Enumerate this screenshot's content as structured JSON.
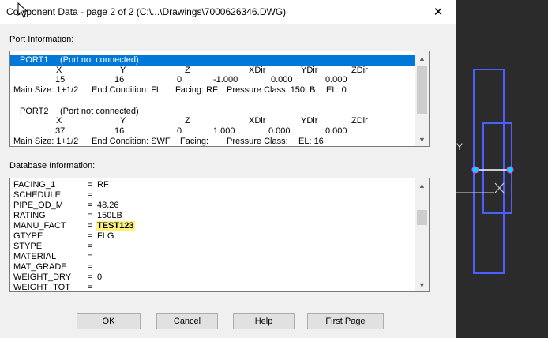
{
  "titlebar": {
    "title": "Component Data - page 2 of 2 (C:\\...\\Drawings\\7000626346.DWG)",
    "close_label": "✕"
  },
  "port_info": {
    "label": "Port Information:",
    "ports": [
      {
        "header": "PORT1",
        "status": "(Port not connected)",
        "col_headers": [
          "X",
          "Y",
          "Z",
          "XDir",
          "YDir",
          "ZDir"
        ],
        "values": [
          "15",
          "16",
          "0",
          "-1.000",
          "0.000",
          "0.000"
        ],
        "main_size": "Main Size: 1+1/2",
        "end_condition": "End Condition: FL",
        "facing": "Facing: RF",
        "pressure_class": "Pressure Class: 150LB",
        "el": "EL: 0"
      },
      {
        "header": "PORT2",
        "status": "(Port not connected)",
        "col_headers": [
          "X",
          "Y",
          "Z",
          "XDir",
          "YDir",
          "ZDir"
        ],
        "values": [
          "37",
          "16",
          "0",
          "1.000",
          "0.000",
          "0.000"
        ],
        "main_size": "Main Size: 1+1/2",
        "end_condition": "End Condition: SWF",
        "facing": "Facing:",
        "pressure_class": "Pressure Class:",
        "el": "EL: 16"
      }
    ]
  },
  "db_info": {
    "label": "Database Information:",
    "rows": [
      {
        "key": "FACING_1",
        "eq": "=",
        "value": "RF"
      },
      {
        "key": "SCHEDULE",
        "eq": "=",
        "value": ""
      },
      {
        "key": "PIPE_OD_M",
        "eq": "=",
        "value": "48.26"
      },
      {
        "key": "RATING",
        "eq": "=",
        "value": "150LB"
      },
      {
        "key": "MANU_FACT",
        "eq": "=",
        "value": "TEST123"
      },
      {
        "key": "GTYPE",
        "eq": "=",
        "value": "FLG"
      },
      {
        "key": "STYPE",
        "eq": "=",
        "value": ""
      },
      {
        "key": "MATERIAL",
        "eq": "=",
        "value": ""
      },
      {
        "key": "MAT_GRADE",
        "eq": "=",
        "value": ""
      },
      {
        "key": "WEIGHT_DRY",
        "eq": "=",
        "value": "0"
      },
      {
        "key": "WEIGHT_TOT",
        "eq": "=",
        "value": ""
      }
    ]
  },
  "buttons": {
    "ok": "OK",
    "cancel": "Cancel",
    "help": "Help",
    "first_page": "First Page"
  },
  "cad_view": {
    "ucs_y_label": "Y",
    "ucs_x_label": "X",
    "outline_color": "#4a5fff",
    "grip_color": "#00d8ff"
  }
}
